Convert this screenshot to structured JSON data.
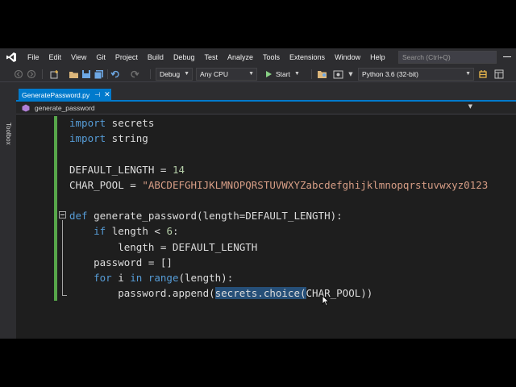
{
  "menu": {
    "items": [
      "File",
      "Edit",
      "View",
      "Git",
      "Project",
      "Build",
      "Debug",
      "Test",
      "Analyze",
      "Tools",
      "Extensions",
      "Window",
      "Help"
    ],
    "search_placeholder": "Search (Ctrl+Q)"
  },
  "toolbar": {
    "config": "Debug",
    "platform": "Any CPU",
    "start_label": "Start",
    "environment": "Python 3.6 (32-bit)"
  },
  "side": {
    "toolbox_label": "Toolbox"
  },
  "tabs": [
    {
      "label": "GeneratePassword.py",
      "active": true
    }
  ],
  "navbar": {
    "member": "generate_password"
  },
  "colors": {
    "accent": "#007acc",
    "keyword": "#569cd6",
    "number": "#b5cea8",
    "string": "#d69d85",
    "selection": "#264f78",
    "change_marker": "#57a64a"
  },
  "code": {
    "lines": [
      [
        {
          "t": "import",
          "k": "kw"
        },
        {
          "t": " secrets",
          "k": "id"
        }
      ],
      [
        {
          "t": "import",
          "k": "kw"
        },
        {
          "t": " string",
          "k": "id"
        }
      ],
      [],
      [
        {
          "t": "DEFAULT_LENGTH = ",
          "k": "id"
        },
        {
          "t": "14",
          "k": "num"
        }
      ],
      [
        {
          "t": "CHAR_POOL = ",
          "k": "id"
        },
        {
          "t": "\"ABCDEFGHIJKLMNOPQRSTUVWXYZabcdefghijklmnopqrstuvwxyz0123",
          "k": "str"
        }
      ],
      [],
      [
        {
          "t": "def",
          "k": "kw"
        },
        {
          "t": " generate_password(length=DEFAULT_LENGTH):",
          "k": "id"
        }
      ],
      [
        {
          "t": "    ",
          "k": "id"
        },
        {
          "t": "if",
          "k": "kw"
        },
        {
          "t": " length < ",
          "k": "id"
        },
        {
          "t": "6",
          "k": "num"
        },
        {
          "t": ":",
          "k": "id"
        }
      ],
      [
        {
          "t": "        length = DEFAULT_LENGTH",
          "k": "id"
        }
      ],
      [
        {
          "t": "    password = []",
          "k": "id"
        }
      ],
      [
        {
          "t": "    ",
          "k": "id"
        },
        {
          "t": "for",
          "k": "kw"
        },
        {
          "t": " i ",
          "k": "id"
        },
        {
          "t": "in",
          "k": "kw"
        },
        {
          "t": " ",
          "k": "id"
        },
        {
          "t": "range",
          "k": "kw"
        },
        {
          "t": "(length):",
          "k": "id"
        }
      ],
      [
        {
          "t": "        password.append(",
          "k": "id"
        },
        {
          "t": "secrets.choice(",
          "k": "sel"
        },
        {
          "t": "CHAR_POOL))",
          "k": "id"
        }
      ]
    ]
  }
}
